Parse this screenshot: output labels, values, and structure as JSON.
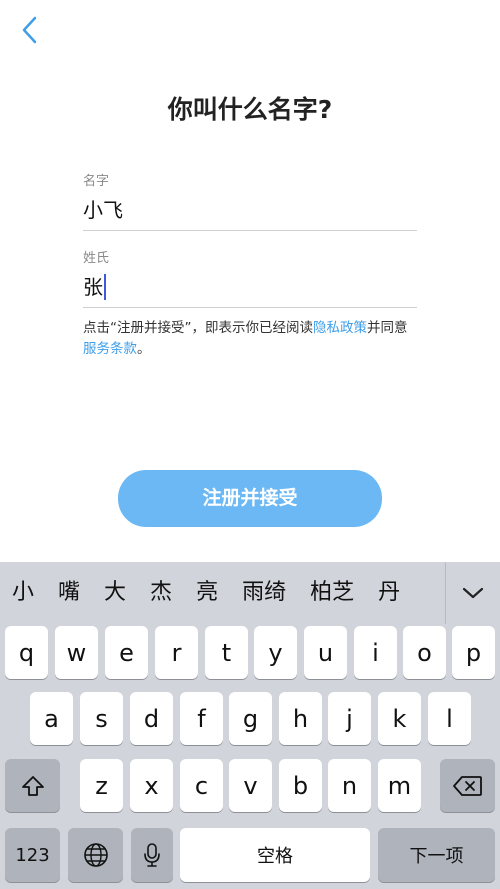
{
  "header": {
    "back_icon": "chevron-left-icon"
  },
  "title": "你叫什么名字?",
  "form": {
    "first_name_label": "名字",
    "first_name_value": "小飞",
    "last_name_label": "姓氏",
    "last_name_value": "张"
  },
  "terms": {
    "prefix": "点击“注册并接受”，即表示你已经阅读",
    "privacy_link": "隐私政策",
    "middle": "并同意",
    "service_link": "服务条款",
    "suffix": "。"
  },
  "submit_label": "注册并接受",
  "keyboard": {
    "candidates": [
      "小",
      "嘴",
      "大",
      "杰",
      "亮",
      "雨绮",
      "柏芝",
      "丹"
    ],
    "row1": [
      "q",
      "w",
      "e",
      "r",
      "t",
      "y",
      "u",
      "i",
      "o",
      "p"
    ],
    "row2": [
      "a",
      "s",
      "d",
      "f",
      "g",
      "h",
      "j",
      "k",
      "l"
    ],
    "row3": [
      "z",
      "x",
      "c",
      "v",
      "b",
      "n",
      "m"
    ],
    "numbers_label": "123",
    "space_label": "空格",
    "next_label": "下一项",
    "colors": {
      "keyboard_bg": "#d1d4da",
      "key_bg": "#ffffff",
      "fn_key_bg": "#aeb3bc",
      "accent": "#6cb8f4",
      "link": "#3f9ee8"
    }
  }
}
